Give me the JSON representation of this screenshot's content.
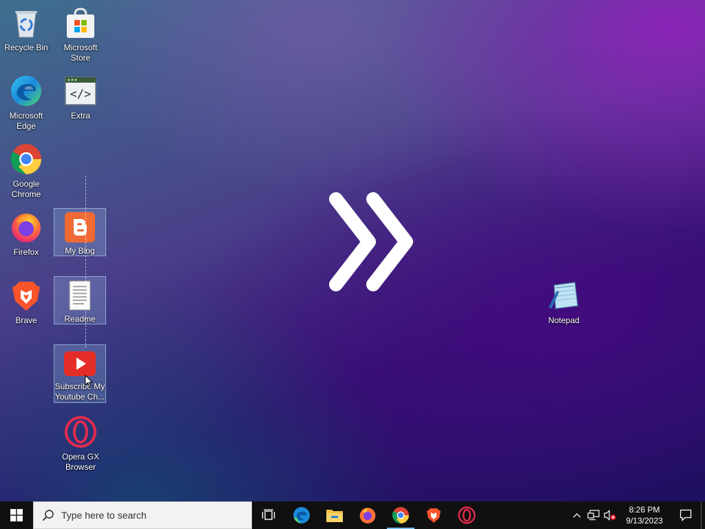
{
  "desktop": {
    "icons": {
      "recycle_bin": "Recycle Bin",
      "microsoft_store": "Microsoft Store",
      "microsoft_edge": "Microsoft Edge",
      "extra": "Extra",
      "google_chrome": "Google Chrome",
      "firefox": "Firefox",
      "my_blog": "My Blog",
      "brave": "Brave",
      "readme": "Readme",
      "youtube": "Subscribe My Youtube Ch...",
      "opera_gx": "Opera GX Browser",
      "notepad": "Notepad"
    }
  },
  "taskbar": {
    "search_placeholder": "Type here to search",
    "pinned_apps": [
      "task-view",
      "microsoft-edge",
      "file-explorer",
      "firefox",
      "google-chrome",
      "brave",
      "opera-gx"
    ],
    "active_app": "google-chrome",
    "clock": {
      "time": "8:26 PM",
      "date": "9/13/2023"
    }
  },
  "colors": {
    "taskbar_bg": "#101010",
    "active_indicator": "#76b9ed",
    "selection": "#96bee6"
  }
}
